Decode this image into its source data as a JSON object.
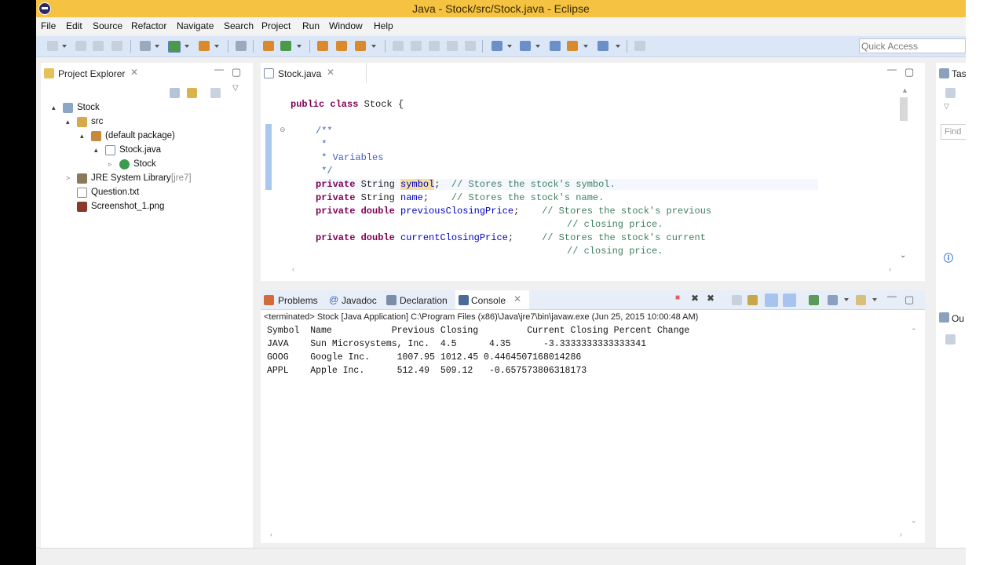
{
  "window": {
    "title": "Java - Stock/src/Stock.java - Eclipse"
  },
  "menu": [
    "File",
    "Edit",
    "Source",
    "Refactor",
    "Navigate",
    "Search",
    "Project",
    "Run",
    "Window",
    "Help"
  ],
  "toolbar": {
    "quick_access_placeholder": "Quick Access"
  },
  "project_explorer": {
    "tab_label": "Project Explorer",
    "tree": [
      {
        "label": "Stock",
        "icon": "project-icon",
        "expander": "▴"
      },
      {
        "label": "src",
        "icon": "package-folder-icon",
        "expander": "▴"
      },
      {
        "label": "(default package)",
        "icon": "package-icon",
        "expander": "▴"
      },
      {
        "label": "Stock.java",
        "icon": "java-file-icon",
        "expander": "▴"
      },
      {
        "label": "Stock",
        "icon": "class-icon",
        "expander": "▹"
      },
      {
        "label": "JRE System Library",
        "suffix": "[jre7]",
        "icon": "library-icon",
        "expander": ">"
      },
      {
        "label": "Question.txt",
        "icon": "text-file-icon",
        "expander": ""
      },
      {
        "label": "Screenshot_1.png",
        "icon": "image-file-icon",
        "expander": ""
      }
    ]
  },
  "editor": {
    "tab_label": "Stock.java",
    "lines": {
      "class_kw": "public class",
      "class_name": " Stock {",
      "jd_open": "/**",
      "jd_star1": " *",
      "jd_vars": " * Variables",
      "jd_close": " */",
      "f1_kw": "private",
      "f1_type": " String ",
      "f1_name": "symbol",
      "f1_rest": ";  ",
      "f1_cm": "// Stores the stock's symbol.",
      "f2_kw": "private",
      "f2_type": " String ",
      "f2_name": "name",
      "f2_rest": ";    ",
      "f2_cm": "// Stores the stock's name.",
      "f3_kw": "private double",
      "f3_name": " previousClosingPrice",
      "f3_rest": ";    ",
      "f3_cm": "// Stores the stock's previous",
      "f3_cm2": "// closing price.",
      "f4_kw": "private double",
      "f4_name": " currentClosingPrice",
      "f4_rest": ";     ",
      "f4_cm": "// Stores the stock's current",
      "f4_cm2": "// closing price."
    }
  },
  "bottom_tabs": {
    "problems": "Problems",
    "javadoc": "Javadoc",
    "declaration": "Declaration",
    "console": "Console"
  },
  "console": {
    "status": "<terminated> Stock [Java Application] C:\\Program Files (x86)\\Java\\jre7\\bin\\javaw.exe (Jun 25, 2015 10:00:48 AM)",
    "lines": [
      "Symbol  Name           Previous Closing         Current Closing Percent Change",
      "JAVA    Sun Microsystems, Inc.  4.5      4.35      -3.3333333333333341",
      "GOOG    Google Inc.     1007.95 1012.45 0.4464507168014286",
      "APPL    Apple Inc.      512.49  509.12   -0.657573806318173"
    ]
  },
  "right_panel": {
    "tab_label": "Tas",
    "find_placeholder": "Find",
    "outline_label": "Ou"
  }
}
